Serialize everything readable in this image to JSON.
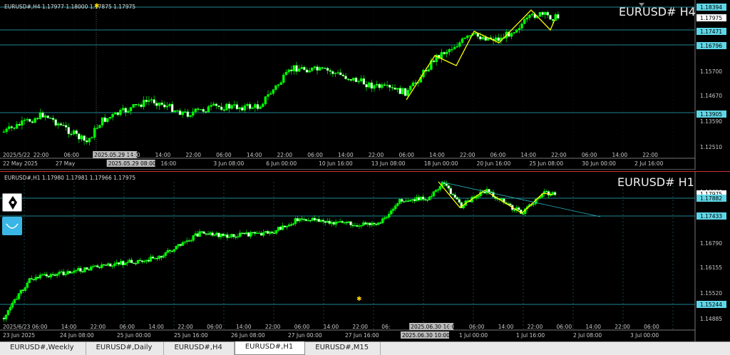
{
  "colors": {
    "bull": "#00ff00",
    "bear": "#ffffff",
    "grid": "#1e1e1e",
    "hline": "#2bb3c0",
    "zigzag": "#ffff00",
    "axis_text": "#c8c8c8",
    "price_tag_bg": "#5fd6e6",
    "price_tag_current_bg": "#ffffff",
    "trendline": "#2bb3c0",
    "tab_bar": "#e9e9e9"
  },
  "top_chart": {
    "info": "EURUSD#,H4  1.17977 1.18000 1.17875 1.17975",
    "watermark": "EURUSD# H4",
    "price_axis_labels": [
      "1.18394",
      "1.17975",
      "1.17471",
      "1.16796",
      "1.15700",
      "1.14670",
      "1.13905",
      "1.13590",
      "1.12510"
    ],
    "hlines": [
      "1.18394",
      "1.17471",
      "1.16796",
      "1.13905"
    ],
    "current_price": "1.17975",
    "time_labels_row1": [
      "2025/5/22",
      "22:00",
      "06:00",
      "2025.05.29 14:00",
      "06:00",
      "14:00",
      "22:00",
      "06:00",
      "14:00",
      "22:00",
      "06:00",
      "14:00",
      "22:00",
      "06:00",
      "14:00",
      "22:00",
      "06:00",
      "14:00",
      "22:00",
      "06:00",
      "14:00",
      "22:00"
    ],
    "time_labels_row2": [
      "22 May 2025",
      "27 May",
      "2025.05.29 08:00",
      "16:00",
      "3 Jun 08:00",
      "6 Jun 00:00",
      "10 Jun 16:00",
      "13 Jun 08:00",
      "18 Jun 00:00",
      "20 Jun 16:00",
      "25 Jun 08:00",
      "30 Jun 00:00",
      "2 Jul 16:00"
    ]
  },
  "bottom_chart": {
    "info": "EURUSD#,H1  1.17980 1.17981 1.17966 1.17975",
    "watermark": "EURUSD# H1",
    "price_axis_labels": [
      "1.18050",
      "1.17975",
      "1.17882",
      "1.17433",
      "1.16790",
      "1.16155",
      "1.15520",
      "1.15244",
      "1.14885"
    ],
    "hlines": [
      "1.17882",
      "1.17433",
      "1.15244"
    ],
    "current_price": "1.17975",
    "time_labels_row1": [
      "2025/6/23",
      "06:00",
      "14:00",
      "22:00",
      "06:00",
      "14:00",
      "22:00",
      "06:00",
      "14:00",
      "22:00",
      "06:00",
      "14:00",
      "22:00",
      "06:",
      "2025.06.30 16:00",
      "2:00",
      "06:00",
      "14:00",
      "22:00",
      "06:00",
      "14:00",
      "22:00",
      "06:00"
    ],
    "time_labels_row2": [
      "23 Jun 2025",
      "24 Jun 08:00",
      "25 Jun 00:00",
      "25 Jun 16:00",
      "26 Jun 08:00",
      "27 Jun 00:00",
      "27 Jun 16:00",
      "2025.06.30 10:00",
      "1 Jul 00:00",
      "1 Jul 16:00",
      "2 Jul 08:00",
      "3 Jul 00:00"
    ]
  },
  "tabs": [
    "EURUSD#,Weekly",
    "EURUSD#,Daily",
    "EURUSD#,H4",
    "EURUSD#,H1",
    "EURUSD#,M15"
  ],
  "active_tab": "EURUSD#,H1",
  "tools": [
    "pen-icon",
    "smile-curve-icon"
  ]
}
